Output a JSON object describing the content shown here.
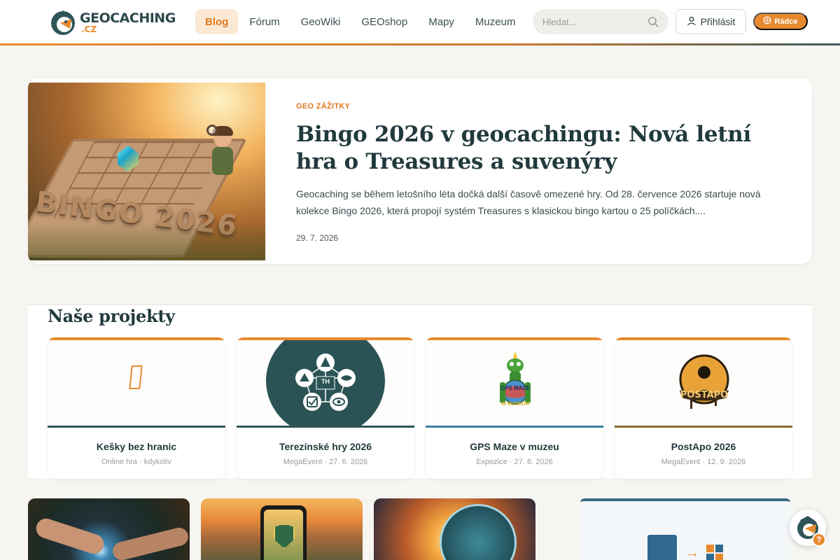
{
  "header": {
    "logo_word": "GEOCACHING",
    "logo_suffix": ".CZ",
    "nav": [
      {
        "label": "Blog",
        "active": true
      },
      {
        "label": "Fórum"
      },
      {
        "label": "GeoWiki"
      },
      {
        "label": "GEOshop"
      },
      {
        "label": "Mapy"
      },
      {
        "label": "Muzeum"
      }
    ],
    "search_placeholder": "Hledat...",
    "login_label": "Přihlásit",
    "radce_label": "Rádce"
  },
  "featured": {
    "category": "GEO ZÁŽITKY",
    "title": "Bingo 2026 v geocachingu: Nová letní hra o Treasures a suvenýry",
    "excerpt": "Geocaching se během letošního léta dočká další časově omezené hry. Od 28. července 2026 startuje nová kolekce Bingo 2026, která propojí systém Treasures s klasickou bingo kartou o 25 políčkách....",
    "date": "29. 7. 2026",
    "image_text": "BINGO 2026"
  },
  "projects": {
    "title": "Naše projekty",
    "items": [
      {
        "name": "Kešky bez hranic",
        "meta": "Online hra · kdykoliv",
        "accent": "#2e5457"
      },
      {
        "name": "Terezínské hry 2026",
        "meta": "MegaEvent · 27. 6. 2026",
        "accent": "#2e5457"
      },
      {
        "name": "GPS Maze v muzeu",
        "meta": "Expozice · 27. 6. 2026",
        "accent": "#3a7ea1"
      },
      {
        "name": "PostApo 2026",
        "meta": "MegaEvent · 12. 9. 2026",
        "accent": "#8a6a2e"
      }
    ],
    "th_badge_text": "TH",
    "gps_badge_text": "GPS MAZE",
    "gps_badge_sub": "IN MUSEUM",
    "postapo_badge_text": "POSTAPO"
  },
  "helper": {
    "question": "?"
  },
  "colors": {
    "accent": "#e8892e",
    "dark": "#223a3d",
    "bg": "#f7f5f1"
  }
}
